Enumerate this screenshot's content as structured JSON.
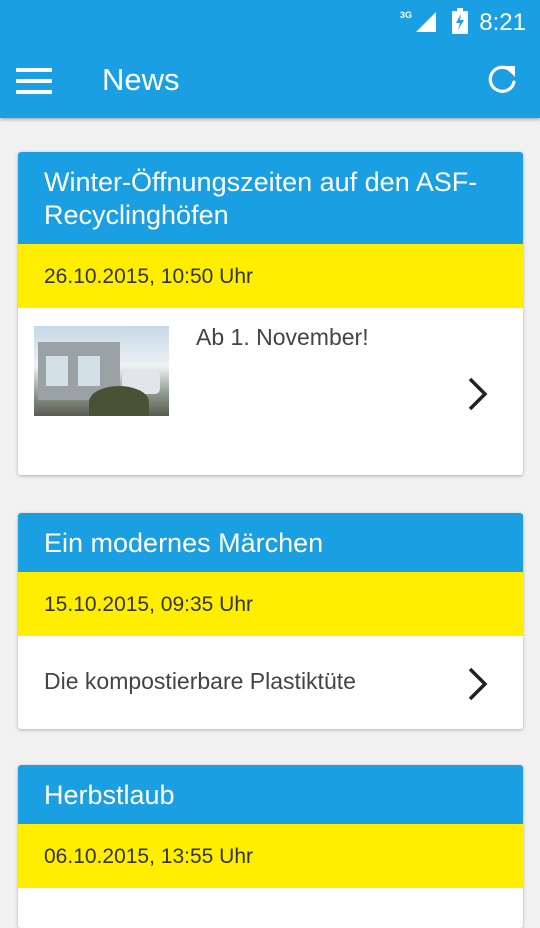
{
  "status_bar": {
    "network": "3G",
    "time": "8:21"
  },
  "app_bar": {
    "title": "News"
  },
  "articles": [
    {
      "title": "Winter-Öffnungszeiten auf den ASF-Recyclinghöfen",
      "date": "26.10.2015, 10:50 Uhr",
      "summary": "Ab 1. November!"
    },
    {
      "title": "Ein modernes Märchen",
      "date": "15.10.2015, 09:35 Uhr",
      "summary": "Die kompostierbare Plastiktüte"
    },
    {
      "title": "Herbstlaub",
      "date": "06.10.2015, 13:55 Uhr",
      "summary": ""
    }
  ],
  "colors": {
    "primary": "#1b9fe3",
    "date_band": "#ffee00",
    "background": "#f1f1f1"
  }
}
